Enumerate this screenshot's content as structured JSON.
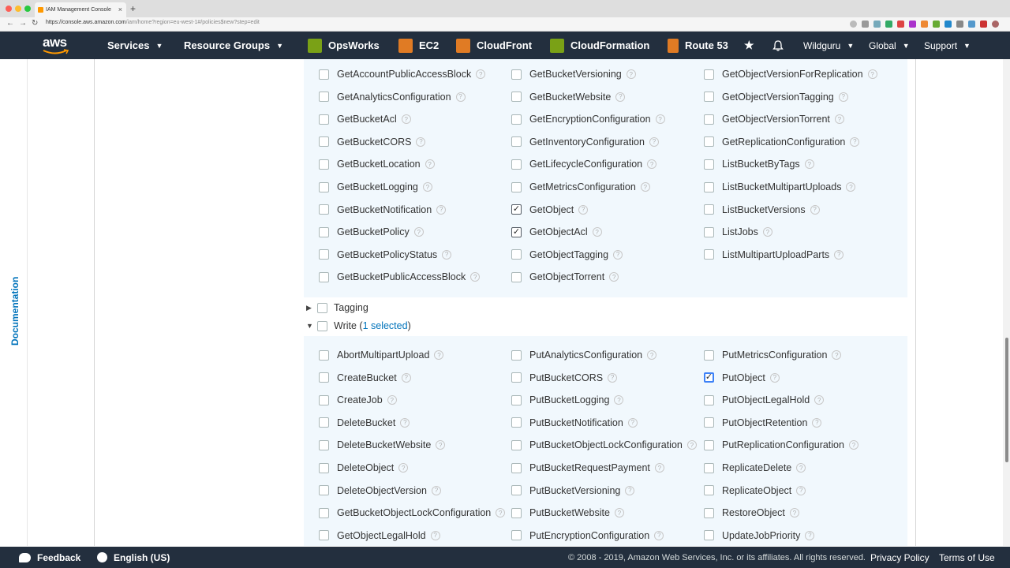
{
  "browser": {
    "tab_title": "IAM Management Console",
    "url_host": "https://console.aws.amazon.com",
    "url_path": "/iam/home?region=eu-west-1#/policies$new?step=edit"
  },
  "nav": {
    "services": "Services",
    "resource_groups": "Resource Groups",
    "shortcuts": [
      {
        "label": "OpsWorks",
        "color": "#7aa116"
      },
      {
        "label": "EC2",
        "color": "#e07b24"
      },
      {
        "label": "CloudFront",
        "color": "#e07b24"
      },
      {
        "label": "CloudFormation",
        "color": "#7aa116"
      },
      {
        "label": "Route 53",
        "color": "#e07b24"
      }
    ],
    "user": "Wildguru",
    "region": "Global",
    "support": "Support"
  },
  "sidebar": {
    "documentation": "Documentation"
  },
  "read_actions": [
    [
      {
        "label": "GetAccountPublicAccessBlock",
        "checked": false
      },
      {
        "label": "GetAnalyticsConfiguration",
        "checked": false
      },
      {
        "label": "GetBucketAcl",
        "checked": false
      },
      {
        "label": "GetBucketCORS",
        "checked": false
      },
      {
        "label": "GetBucketLocation",
        "checked": false
      },
      {
        "label": "GetBucketLogging",
        "checked": false
      },
      {
        "label": "GetBucketNotification",
        "checked": false
      },
      {
        "label": "GetBucketPolicy",
        "checked": false
      },
      {
        "label": "GetBucketPolicyStatus",
        "checked": false
      },
      {
        "label": "GetBucketPublicAccessBlock",
        "checked": false
      }
    ],
    [
      {
        "label": "GetBucketVersioning",
        "checked": false
      },
      {
        "label": "GetBucketWebsite",
        "checked": false
      },
      {
        "label": "GetEncryptionConfiguration",
        "checked": false
      },
      {
        "label": "GetInventoryConfiguration",
        "checked": false
      },
      {
        "label": "GetLifecycleConfiguration",
        "checked": false
      },
      {
        "label": "GetMetricsConfiguration",
        "checked": false
      },
      {
        "label": "GetObject",
        "checked": true
      },
      {
        "label": "GetObjectAcl",
        "checked": true
      },
      {
        "label": "GetObjectTagging",
        "checked": false
      },
      {
        "label": "GetObjectTorrent",
        "checked": false
      }
    ],
    [
      {
        "label": "GetObjectVersionForReplication",
        "checked": false
      },
      {
        "label": "GetObjectVersionTagging",
        "checked": false
      },
      {
        "label": "GetObjectVersionTorrent",
        "checked": false
      },
      {
        "label": "GetReplicationConfiguration",
        "checked": false
      },
      {
        "label": "ListBucketByTags",
        "checked": false
      },
      {
        "label": "ListBucketMultipartUploads",
        "checked": false
      },
      {
        "label": "ListBucketVersions",
        "checked": false
      },
      {
        "label": "ListJobs",
        "checked": false
      },
      {
        "label": "ListMultipartUploadParts",
        "checked": false
      }
    ]
  ],
  "groups": {
    "tagging": {
      "label": "Tagging"
    },
    "write": {
      "label": "Write (",
      "selected": "1 selected",
      "suffix": ")"
    }
  },
  "write_actions": [
    [
      {
        "label": "AbortMultipartUpload",
        "checked": false
      },
      {
        "label": "CreateBucket",
        "checked": false
      },
      {
        "label": "CreateJob",
        "checked": false
      },
      {
        "label": "DeleteBucket",
        "checked": false
      },
      {
        "label": "DeleteBucketWebsite",
        "checked": false
      },
      {
        "label": "DeleteObject",
        "checked": false
      },
      {
        "label": "DeleteObjectVersion",
        "checked": false
      },
      {
        "label": "GetBucketObjectLockConfiguration",
        "checked": false
      },
      {
        "label": "GetObjectLegalHold",
        "checked": false
      }
    ],
    [
      {
        "label": "PutAnalyticsConfiguration",
        "checked": false
      },
      {
        "label": "PutBucketCORS",
        "checked": false
      },
      {
        "label": "PutBucketLogging",
        "checked": false
      },
      {
        "label": "PutBucketNotification",
        "checked": false
      },
      {
        "label": "PutBucketObjectLockConfiguration",
        "checked": false
      },
      {
        "label": "PutBucketRequestPayment",
        "checked": false
      },
      {
        "label": "PutBucketVersioning",
        "checked": false
      },
      {
        "label": "PutBucketWebsite",
        "checked": false
      },
      {
        "label": "PutEncryptionConfiguration",
        "checked": false
      }
    ],
    [
      {
        "label": "PutMetricsConfiguration",
        "checked": false
      },
      {
        "label": "PutObject",
        "checked": true
      },
      {
        "label": "PutObjectLegalHold",
        "checked": false
      },
      {
        "label": "PutObjectRetention",
        "checked": false
      },
      {
        "label": "PutReplicationConfiguration",
        "checked": false
      },
      {
        "label": "ReplicateDelete",
        "checked": false
      },
      {
        "label": "ReplicateObject",
        "checked": false
      },
      {
        "label": "RestoreObject",
        "checked": false
      },
      {
        "label": "UpdateJobPriority",
        "checked": false
      }
    ]
  ],
  "footer": {
    "feedback": "Feedback",
    "language": "English (US)",
    "copyright": "© 2008 - 2019, Amazon Web Services, Inc. or its affiliates. All rights reserved.",
    "privacy": "Privacy Policy",
    "terms": "Terms of Use"
  }
}
